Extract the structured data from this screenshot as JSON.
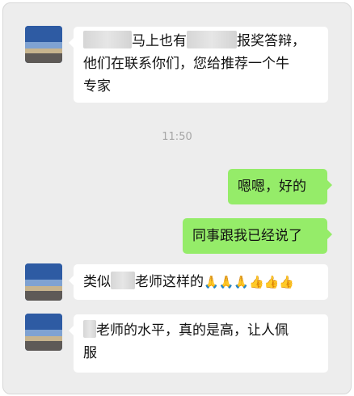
{
  "messages": [
    {
      "sender": "other",
      "text_part1": "马上也有",
      "text_part2": "报奖答辩，",
      "line2": "他们在联系你们，您给推荐一个牛",
      "line3": "专家"
    },
    {
      "type": "timestamp",
      "text": "11:50"
    },
    {
      "sender": "me",
      "text": "嗯嗯，好的"
    },
    {
      "sender": "me",
      "text": "同事跟我已经说了"
    },
    {
      "sender": "other",
      "text_part1": "类似",
      "text_part2": "老师这样的",
      "emojis": "🙏🙏🙏👍👍👍"
    },
    {
      "sender": "other",
      "text_part1": "老师的水平，真的是高，让人佩",
      "line2": "服"
    }
  ],
  "colors": {
    "background": "#ededed",
    "bubble_me": "#95ec69",
    "bubble_other": "#ffffff"
  },
  "icons": [
    "avatar-sky-photo"
  ]
}
